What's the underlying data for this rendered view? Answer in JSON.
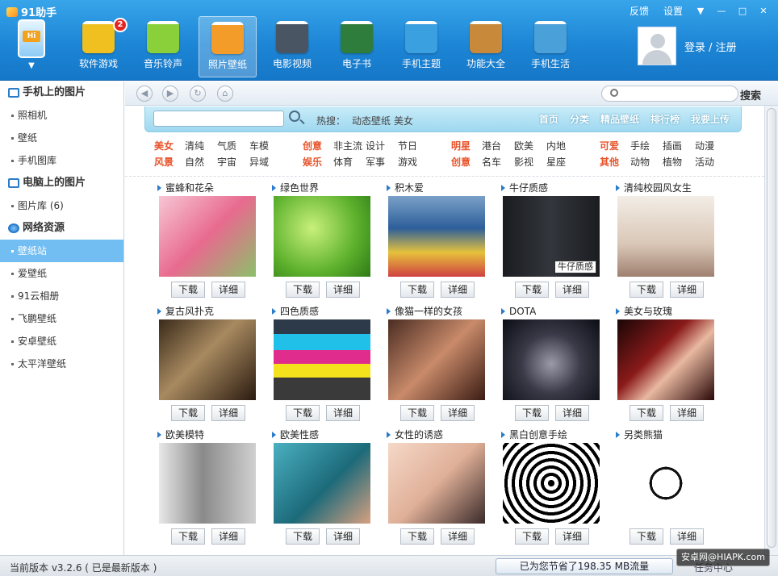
{
  "window": {
    "title": "91助手",
    "controls": {
      "feedback": "反馈",
      "settings": "设置",
      "menu": "▼",
      "minimize": "—",
      "maximize": "□",
      "close": "✕"
    }
  },
  "toolbar": {
    "badge": "2",
    "phone_label": "Hi",
    "phone_arrow": "▼",
    "items": [
      {
        "label": "软件游戏",
        "color": "#f0c020"
      },
      {
        "label": "音乐铃声",
        "color": "#8ad03a"
      },
      {
        "label": "照片壁纸",
        "color": "#f39c2a"
      },
      {
        "label": "电影视频",
        "color": "#4a5563"
      },
      {
        "label": "电子书",
        "color": "#2f7d3c"
      },
      {
        "label": "手机主题",
        "color": "#3aa0e0"
      },
      {
        "label": "功能大全",
        "color": "#c88a3a"
      },
      {
        "label": "手机生活",
        "color": "#4aa0d8"
      }
    ],
    "active_index": 2,
    "login": "登录 / 注册"
  },
  "sidebar": {
    "sections": [
      {
        "title": "手机上的图片",
        "icon": "phone-photo-icon",
        "items": [
          "照相机",
          "壁纸",
          "手机图库"
        ]
      },
      {
        "title": "电脑上的图片",
        "icon": "pc-photo-icon",
        "items": [
          "图片库 (6)"
        ]
      },
      {
        "title": "网络资源",
        "icon": "globe-icon",
        "items": [
          "壁纸站",
          "爱壁纸",
          "91云相册",
          "飞鹏壁纸",
          "安卓壁纸",
          "太平洋壁纸"
        ]
      }
    ],
    "selected": "壁纸站"
  },
  "nav": {
    "back": "◀",
    "forward": "▶",
    "refresh": "↻",
    "home": "⌂",
    "search_btn": "搜索",
    "url": ""
  },
  "site": {
    "search_value": "",
    "hot_label": "热搜：",
    "hot_items": [
      "动态壁纸",
      "美女"
    ],
    "nav": [
      "首页",
      "分类",
      "精品壁纸",
      "排行榜",
      "我要上传"
    ],
    "categories": [
      [
        {
          "head": "美女",
          "items": [
            "清纯",
            "气质",
            "车模"
          ]
        },
        {
          "head": "创意",
          "items": [
            "非主流",
            "设计",
            "节日"
          ]
        },
        {
          "head": "明星",
          "items": [
            "港台",
            "欧美",
            "内地"
          ]
        },
        {
          "head": "可爱",
          "items": [
            "手绘",
            "插画",
            "动漫"
          ]
        }
      ],
      [
        {
          "head": "风景",
          "items": [
            "自然",
            "宇宙",
            "异域"
          ]
        },
        {
          "head": "娱乐",
          "items": [
            "体育",
            "军事",
            "游戏"
          ]
        },
        {
          "head": "创意",
          "items": [
            "名车",
            "影视",
            "星座"
          ]
        },
        {
          "head": "其他",
          "items": [
            "动物",
            "植物",
            "活动"
          ]
        }
      ]
    ],
    "button_download": "下载",
    "button_detail": "详细",
    "wallpapers": [
      {
        "title": "蜜蜂和花朵",
        "bg": "linear-gradient(135deg,#f7c6d4,#e86a8f 50%,#8cc06a)"
      },
      {
        "title": "绿色世界",
        "bg": "radial-gradient(circle at 40% 40%,#c8f07a,#5cb02c 60%,#2f7a18)"
      },
      {
        "title": "积木爱",
        "bg": "linear-gradient(#7aa0c8,#2d5f9a 40%,#e6c23c 70%,#d04040)"
      },
      {
        "title": "牛仔质感",
        "bg": "linear-gradient(90deg,#1a1c20,#33363c 50%,#1a1c20)",
        "tag": "牛仔质感"
      },
      {
        "title": "清纯校园风女生",
        "bg": "linear-gradient(#f3ede6,#d9c7b6 60%,#a08070)"
      },
      {
        "title": "复古风扑克",
        "bg": "linear-gradient(135deg,#3a2a1a,#a88a60 45%,#2a1a10)"
      },
      {
        "title": "四色质感",
        "bg": "linear-gradient(#2c3a4a 0 18%,#20c0e8 18% 38%,#e02c8c 38% 55%,#f4e21c 55% 72%,#3a3a3a 72%)"
      },
      {
        "title": "像猫一样的女孩",
        "bg": "linear-gradient(135deg,#4a2c22,#c88a6a 50%,#3a1c14)"
      },
      {
        "title": "DOTA",
        "bg": "radial-gradient(circle at 50% 55%,#9a9aa8,#3a3a48 45%,#0c0c14)"
      },
      {
        "title": "美女与玫瑰",
        "bg": "linear-gradient(135deg,#1a0606,#8a1a1a 40%,#e8b8a0 60%,#2a0808)"
      },
      {
        "title": "欧美模特",
        "bg": "linear-gradient(90deg,#e8e8e8,#8a8a8a 45%,#d0d0d0)"
      },
      {
        "title": "欧美性感",
        "bg": "linear-gradient(135deg,#4ab0c0,#1c6a7a 55%,#d8a080)"
      },
      {
        "title": "女性的诱惑",
        "bg": "linear-gradient(135deg,#f5d8c8,#e0b098 50%,#3a2a2a)"
      },
      {
        "title": "黑白创意手绘",
        "bg": "repeating-radial-gradient(circle at 50% 50%,#000 0 4px,#fff 4px 9px)"
      },
      {
        "title": "另类熊猫",
        "bg": "radial-gradient(circle at 50% 50%,#fff 0 22%,#111 22% 26%,#fff 26%)"
      }
    ]
  },
  "status": {
    "version": "当前版本 v3.2.6 ( 已是最新版本 )",
    "saved": "已为您节省了198.35 MB流量",
    "task_center": "任务中心",
    "watermark": "安卓网@HIAPK.com"
  }
}
